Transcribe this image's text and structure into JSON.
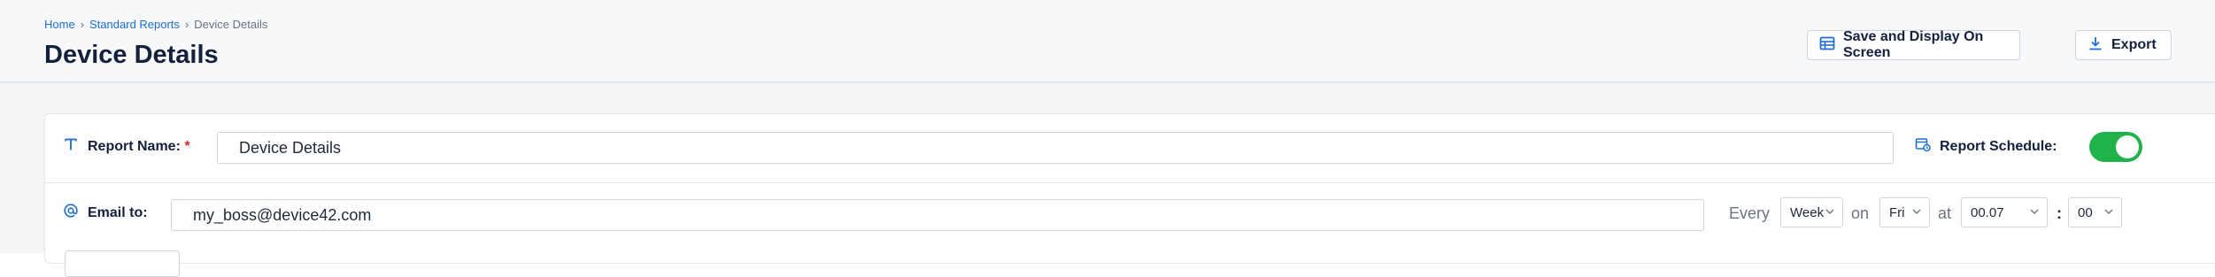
{
  "breadcrumb": {
    "home": "Home",
    "separator": "›",
    "standard_reports": "Standard Reports",
    "current": "Device Details"
  },
  "page_title": "Device Details",
  "toolbar": {
    "save_label": "Save and Display On Screen",
    "export_label": "Export"
  },
  "form": {
    "report_name_label": "Report Name:",
    "required_mark": "*",
    "report_name_value": "Device Details",
    "report_schedule_label": "Report Schedule:",
    "report_schedule_enabled": true,
    "email_label": "Email to:",
    "email_value": "my_boss@device42.com",
    "schedule": {
      "every_text": "Every",
      "frequency": "Week",
      "on_text": "on",
      "day": "Fri",
      "at_text": "at",
      "hour": "00.07",
      "colon": ":",
      "minute": "00"
    }
  },
  "colors": {
    "accent": "#1c6fd1",
    "toggle_on": "#22b24c",
    "required": "#e02424",
    "title": "#14213d"
  }
}
